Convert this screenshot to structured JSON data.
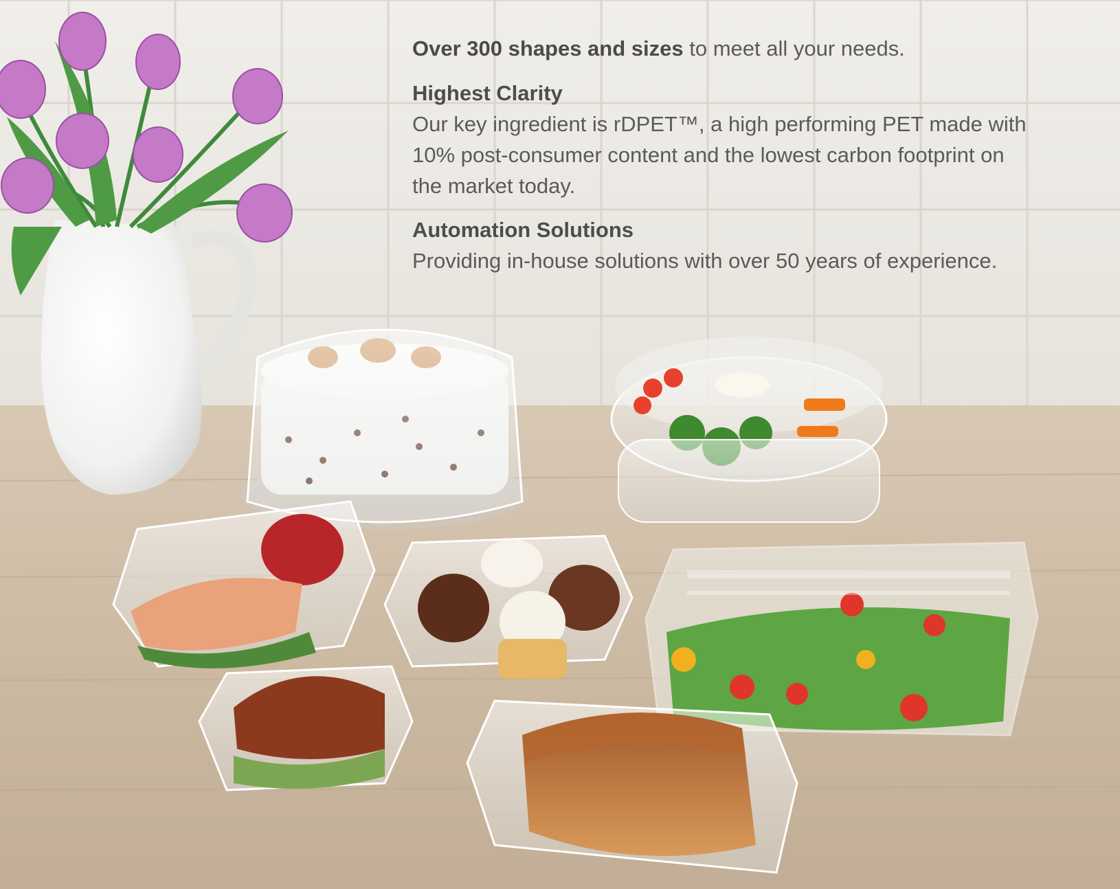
{
  "intro": {
    "bold": "Over 300 shapes and sizes",
    "rest": " to meet all your needs."
  },
  "sections": [
    {
      "heading": "Highest Clarity",
      "body": "Our key ingredient is rDPET™, a high performing PET made with 10% post-consumer content and the lowest carbon footprint on the market today."
    },
    {
      "heading": "Automation Solutions",
      "body": "Providing in-house solutions with over 50 years of experience."
    }
  ]
}
